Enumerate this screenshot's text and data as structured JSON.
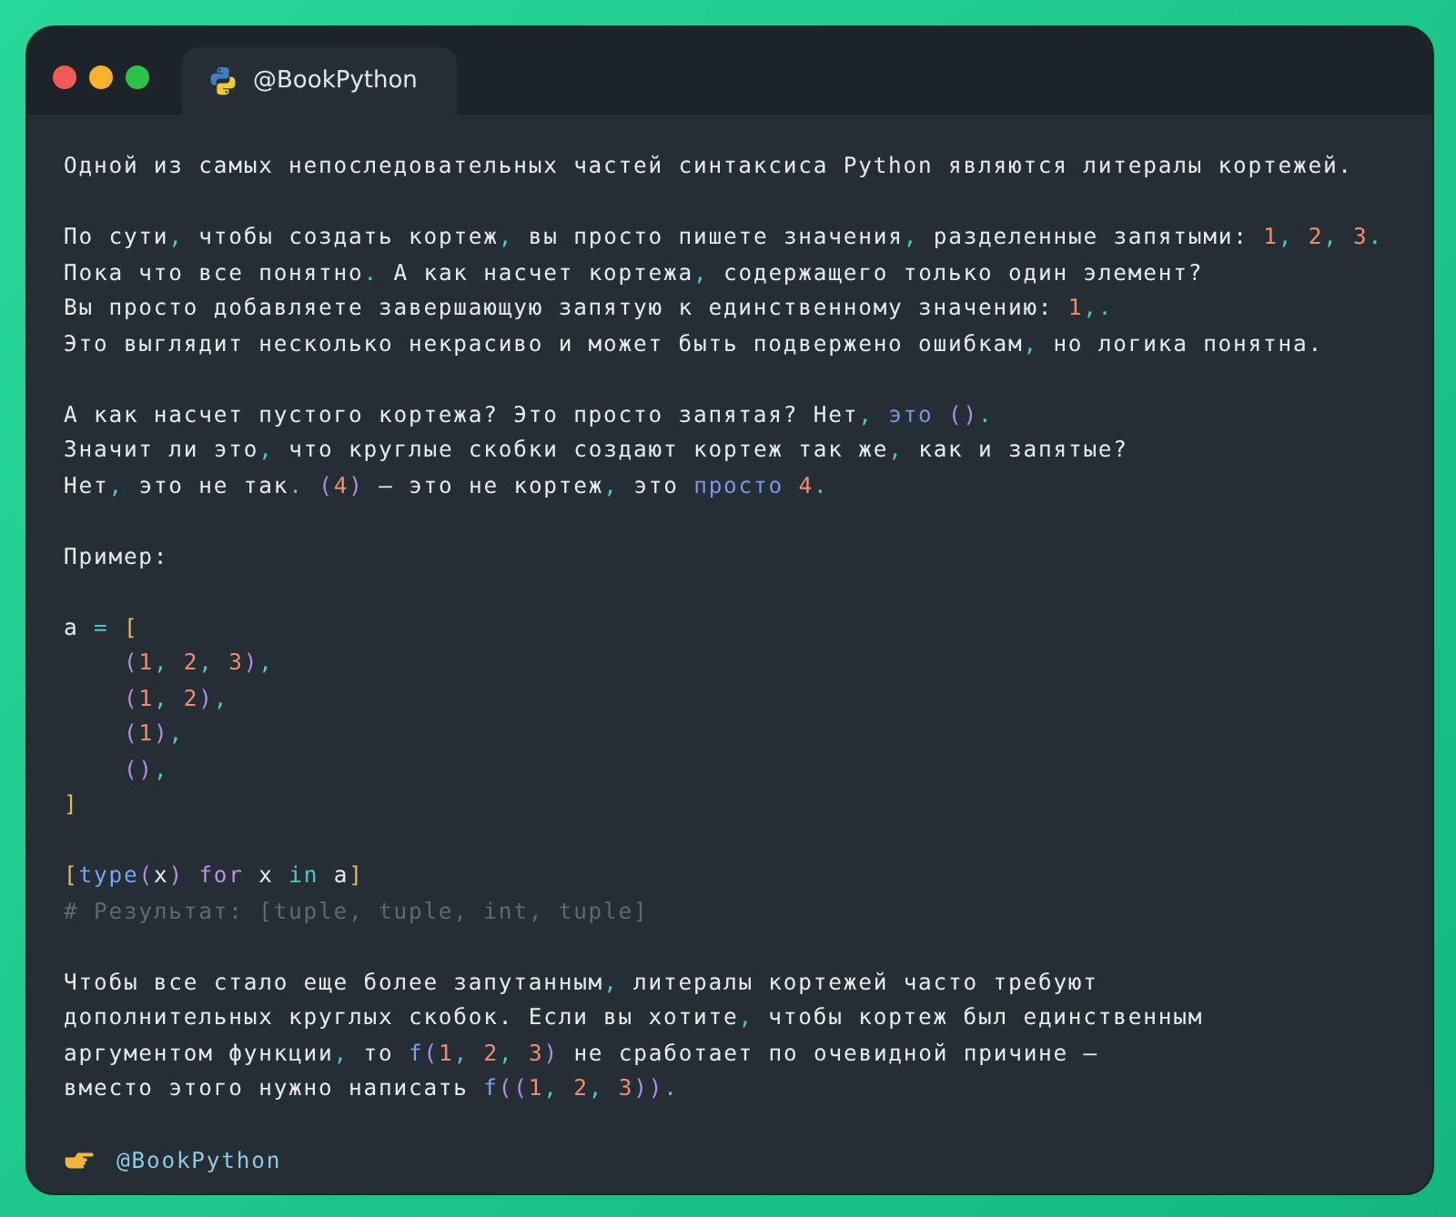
{
  "tab": {
    "label": "@BookPython",
    "selected": true
  },
  "lines": [
    {
      "kind": "text",
      "tokens": [
        {
          "t": "Одной из самых непоследовательных частей синтаксиса Python являются литералы кортежей.",
          "kind": "plain"
        }
      ]
    },
    {
      "kind": "blank"
    },
    {
      "kind": "text",
      "tokens": [
        {
          "t": "По сути",
          "kind": "plain"
        },
        {
          "t": ",",
          "kind": "punct"
        },
        {
          "t": " чтобы создать кортеж",
          "kind": "plain"
        },
        {
          "t": ",",
          "kind": "punct"
        },
        {
          "t": " вы просто пишете значения",
          "kind": "plain"
        },
        {
          "t": ",",
          "kind": "punct"
        },
        {
          "t": " разделенные запятыми: ",
          "kind": "plain"
        },
        {
          "t": "1",
          "kind": "number"
        },
        {
          "t": ", ",
          "kind": "punct"
        },
        {
          "t": "2",
          "kind": "number"
        },
        {
          "t": ", ",
          "kind": "punct"
        },
        {
          "t": "3",
          "kind": "number"
        },
        {
          "t": ".",
          "kind": "punct"
        }
      ]
    },
    {
      "kind": "text",
      "tokens": [
        {
          "t": "Пока что все понятно",
          "kind": "plain"
        },
        {
          "t": ".",
          "kind": "punct"
        },
        {
          "t": " А как насчет кортежа",
          "kind": "plain"
        },
        {
          "t": ",",
          "kind": "punct"
        },
        {
          "t": " содержащего только один элемент?",
          "kind": "plain"
        }
      ]
    },
    {
      "kind": "text",
      "tokens": [
        {
          "t": "Вы просто добавляете завершающую запятую к единственному значению: ",
          "kind": "plain"
        },
        {
          "t": "1",
          "kind": "number"
        },
        {
          "t": ",.",
          "kind": "punct"
        }
      ]
    },
    {
      "kind": "text",
      "tokens": [
        {
          "t": "Это выглядит несколько некрасиво и может быть подвержено ошибкам",
          "kind": "plain"
        },
        {
          "t": ",",
          "kind": "punct"
        },
        {
          "t": " но логика понятна.",
          "kind": "plain"
        }
      ]
    },
    {
      "kind": "blank"
    },
    {
      "kind": "text",
      "tokens": [
        {
          "t": "А как насчет пустого кортежа? Это просто запятая? Нет",
          "kind": "plain"
        },
        {
          "t": ", ",
          "kind": "punct"
        },
        {
          "t": "это ",
          "kind": "builtin"
        },
        {
          "t": "()",
          "kind": "paren"
        },
        {
          "t": ".",
          "kind": "punct"
        }
      ]
    },
    {
      "kind": "text",
      "tokens": [
        {
          "t": "Значит ли это",
          "kind": "plain"
        },
        {
          "t": ",",
          "kind": "punct"
        },
        {
          "t": " что круглые скобки создают кортеж так же",
          "kind": "plain"
        },
        {
          "t": ",",
          "kind": "punct"
        },
        {
          "t": " как и запятые?",
          "kind": "plain"
        }
      ]
    },
    {
      "kind": "text",
      "tokens": [
        {
          "t": "Нет",
          "kind": "plain"
        },
        {
          "t": ",",
          "kind": "punct"
        },
        {
          "t": " это не так",
          "kind": "plain"
        },
        {
          "t": ". ",
          "kind": "punct"
        },
        {
          "t": "(",
          "kind": "paren"
        },
        {
          "t": "4",
          "kind": "number"
        },
        {
          "t": ")",
          "kind": "paren"
        },
        {
          "t": " — это не кортеж",
          "kind": "plain"
        },
        {
          "t": ",",
          "kind": "punct"
        },
        {
          "t": " это ",
          "kind": "plain"
        },
        {
          "t": "просто ",
          "kind": "builtin"
        },
        {
          "t": "4",
          "kind": "number"
        },
        {
          "t": ".",
          "kind": "punct"
        }
      ]
    },
    {
      "kind": "blank"
    },
    {
      "kind": "text",
      "tokens": [
        {
          "t": "Пример:",
          "kind": "plain"
        }
      ]
    },
    {
      "kind": "blank"
    },
    {
      "kind": "code",
      "tokens": [
        {
          "t": "a ",
          "kind": "plain"
        },
        {
          "t": "= ",
          "kind": "punct"
        },
        {
          "t": "[",
          "kind": "bracket"
        }
      ]
    },
    {
      "kind": "code",
      "tokens": [
        {
          "t": "    (",
          "kind": "paren"
        },
        {
          "t": "1",
          "kind": "number"
        },
        {
          "t": ", ",
          "kind": "punct"
        },
        {
          "t": "2",
          "kind": "number"
        },
        {
          "t": ", ",
          "kind": "punct"
        },
        {
          "t": "3",
          "kind": "number"
        },
        {
          "t": ")",
          "kind": "paren"
        },
        {
          "t": ",",
          "kind": "punct"
        }
      ]
    },
    {
      "kind": "code",
      "tokens": [
        {
          "t": "    (",
          "kind": "paren"
        },
        {
          "t": "1",
          "kind": "number"
        },
        {
          "t": ", ",
          "kind": "punct"
        },
        {
          "t": "2",
          "kind": "number"
        },
        {
          "t": ")",
          "kind": "paren"
        },
        {
          "t": ",",
          "kind": "punct"
        }
      ]
    },
    {
      "kind": "code",
      "tokens": [
        {
          "t": "    (",
          "kind": "paren"
        },
        {
          "t": "1",
          "kind": "number"
        },
        {
          "t": ")",
          "kind": "paren"
        },
        {
          "t": ",",
          "kind": "punct"
        }
      ]
    },
    {
      "kind": "code",
      "tokens": [
        {
          "t": "    ()",
          "kind": "paren"
        },
        {
          "t": ",",
          "kind": "punct"
        }
      ]
    },
    {
      "kind": "code",
      "tokens": [
        {
          "t": "]",
          "kind": "bracket"
        }
      ]
    },
    {
      "kind": "blank"
    },
    {
      "kind": "code",
      "tokens": [
        {
          "t": "[",
          "kind": "bracket"
        },
        {
          "t": "type",
          "kind": "func"
        },
        {
          "t": "(",
          "kind": "paren"
        },
        {
          "t": "x",
          "kind": "plain"
        },
        {
          "t": ") ",
          "kind": "paren"
        },
        {
          "t": "for",
          "kind": "keyword"
        },
        {
          "t": " x ",
          "kind": "plain"
        },
        {
          "t": "in",
          "kind": "punct"
        },
        {
          "t": " a",
          "kind": "plain"
        },
        {
          "t": "]",
          "kind": "bracket"
        }
      ]
    },
    {
      "kind": "code",
      "tokens": [
        {
          "t": "# Результат: [tuple, tuple, int, tuple]",
          "kind": "comment"
        }
      ]
    },
    {
      "kind": "blank"
    },
    {
      "kind": "text",
      "tokens": [
        {
          "t": "Чтобы все стало еще более запутанным",
          "kind": "plain"
        },
        {
          "t": ",",
          "kind": "punct"
        },
        {
          "t": " литералы кортежей часто требуют",
          "kind": "plain"
        }
      ]
    },
    {
      "kind": "text",
      "tokens": [
        {
          "t": "дополнительных круглых скобок. Если вы хотите",
          "kind": "plain"
        },
        {
          "t": ",",
          "kind": "punct"
        },
        {
          "t": " чтобы кортеж был единственным",
          "kind": "plain"
        }
      ]
    },
    {
      "kind": "text",
      "tokens": [
        {
          "t": "аргументом функции",
          "kind": "plain"
        },
        {
          "t": ",",
          "kind": "punct"
        },
        {
          "t": " то ",
          "kind": "plain"
        },
        {
          "t": "f",
          "kind": "func"
        },
        {
          "t": "(",
          "kind": "paren"
        },
        {
          "t": "1",
          "kind": "number"
        },
        {
          "t": ", ",
          "kind": "punct"
        },
        {
          "t": "2",
          "kind": "number"
        },
        {
          "t": ", ",
          "kind": "punct"
        },
        {
          "t": "3",
          "kind": "number"
        },
        {
          "t": ")",
          "kind": "paren"
        },
        {
          "t": " не сработает по очевидной причине —",
          "kind": "plain"
        }
      ]
    },
    {
      "kind": "text",
      "tokens": [
        {
          "t": "вместо этого нужно написать ",
          "kind": "plain"
        },
        {
          "t": "f",
          "kind": "func"
        },
        {
          "t": "((",
          "kind": "paren"
        },
        {
          "t": "1",
          "kind": "number"
        },
        {
          "t": ", ",
          "kind": "punct"
        },
        {
          "t": "2",
          "kind": "number"
        },
        {
          "t": ", ",
          "kind": "punct"
        },
        {
          "t": "3",
          "kind": "number"
        },
        {
          "t": "))",
          "kind": "paren"
        },
        {
          "t": ".",
          "kind": "punct"
        }
      ]
    },
    {
      "kind": "blank"
    }
  ],
  "footer": {
    "handle": "@BookPython"
  }
}
